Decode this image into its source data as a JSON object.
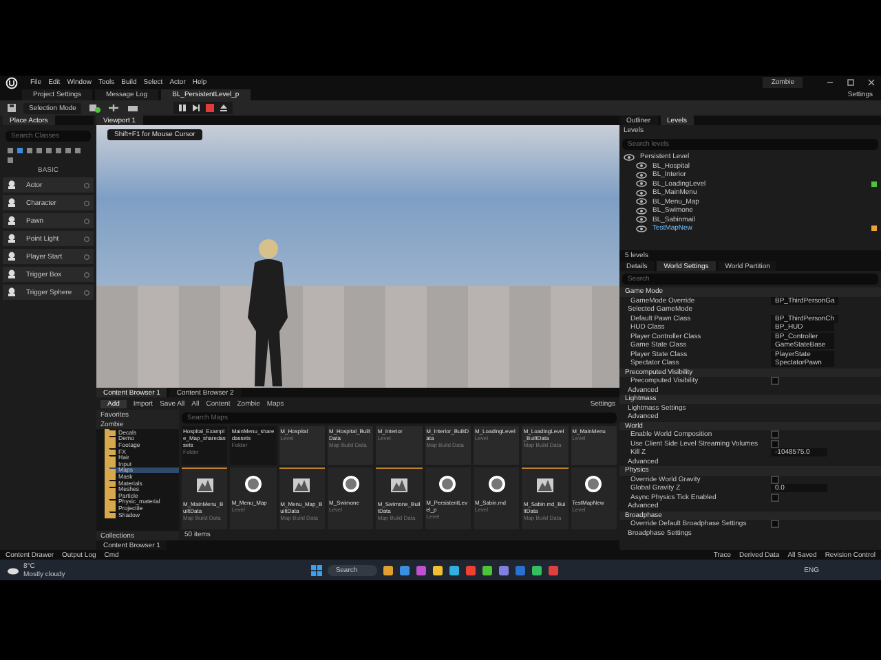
{
  "menu": {
    "items": [
      "File",
      "Edit",
      "Window",
      "Tools",
      "Build",
      "Select",
      "Actor",
      "Help"
    ],
    "project": "Zombie"
  },
  "doc_tabs": [
    {
      "label": "Project Settings",
      "selected": false
    },
    {
      "label": "Message Log",
      "selected": false
    },
    {
      "label": "BL_PersistentLevel_p",
      "selected": true
    }
  ],
  "settings_label": "Settings",
  "toolbar": {
    "mode": "Selection Mode"
  },
  "place_actors": {
    "title": "Place Actors",
    "placeholder": "Search Classes",
    "category": "BASIC",
    "items": [
      "Actor",
      "Character",
      "Pawn",
      "Point Light",
      "Player Start",
      "Trigger Box",
      "Trigger Sphere"
    ]
  },
  "viewport": {
    "tab": "Viewport 1",
    "hint": "Shift+F1 for Mouse Cursor"
  },
  "levels_panel": {
    "tabs": [
      {
        "label": "Outliner",
        "selected": false
      },
      {
        "label": "Levels",
        "selected": true
      }
    ],
    "menu": "Levels",
    "placeholder": "Search levels",
    "footer": "5 levels",
    "levels": [
      {
        "name": "Persistent Level",
        "selected": false,
        "children": [
          {
            "name": "BL_Hospital",
            "selected": false
          },
          {
            "name": "BL_Interior",
            "selected": false
          },
          {
            "name": "BL_LoadingLevel",
            "selected": false,
            "color": "#4cc43a"
          },
          {
            "name": "BL_MainMenu",
            "selected": false
          },
          {
            "name": "BL_Menu_Map",
            "selected": false
          },
          {
            "name": "BL_Swimone",
            "selected": false
          },
          {
            "name": "BL_Sabinmail",
            "selected": false
          },
          {
            "name": "TestMapNew",
            "selected": true,
            "color": "#e8a23a"
          }
        ]
      }
    ]
  },
  "details": {
    "tabs": [
      {
        "label": "Details",
        "selected": false
      },
      {
        "label": "World Settings",
        "selected": true
      },
      {
        "label": "World Partition",
        "selected": false
      }
    ],
    "placeholder": "Search",
    "rows": [
      {
        "kind": "section",
        "label": "Game Mode"
      },
      {
        "kind": "dropdown",
        "label": "GameMode Override",
        "value": "BP_ThirdPersonGa"
      },
      {
        "kind": "group",
        "label": "Selected GameMode"
      },
      {
        "kind": "dropdown",
        "label": "Default Pawn Class",
        "value": "BP_ThirdPersonCh"
      },
      {
        "kind": "dropdown",
        "label": "HUD Class",
        "value": "BP_HUD"
      },
      {
        "kind": "dropdown",
        "label": "Player Controller Class",
        "value": "BP_Controller"
      },
      {
        "kind": "dropdown",
        "label": "Game State Class",
        "value": "GameStateBase"
      },
      {
        "kind": "dropdown",
        "label": "Player State Class",
        "value": "PlayerState"
      },
      {
        "kind": "dropdown",
        "label": "Spectator Class",
        "value": "SpectatorPawn"
      },
      {
        "kind": "section",
        "label": "Precomputed Visibility"
      },
      {
        "kind": "checkbox",
        "label": "Precomputed Visibility",
        "checked": false
      },
      {
        "kind": "group",
        "label": "Advanced"
      },
      {
        "kind": "section",
        "label": "Lightmass"
      },
      {
        "kind": "group",
        "label": "Lightmass Settings"
      },
      {
        "kind": "group",
        "label": "Advanced"
      },
      {
        "kind": "section",
        "label": "World"
      },
      {
        "kind": "checkbox",
        "label": "Enable World Composition",
        "checked": false
      },
      {
        "kind": "checkbox",
        "label": "Use Client Side Level Streaming Volumes",
        "checked": false
      },
      {
        "kind": "text",
        "label": "Kill Z",
        "value": "-1048575.0"
      },
      {
        "kind": "group",
        "label": "Advanced"
      },
      {
        "kind": "section",
        "label": "Physics"
      },
      {
        "kind": "checkbox",
        "label": "Override World Gravity",
        "checked": false
      },
      {
        "kind": "text",
        "label": "Global Gravity Z",
        "value": "0.0"
      },
      {
        "kind": "checkbox",
        "label": "Async Physics Tick Enabled",
        "checked": false
      },
      {
        "kind": "group",
        "label": "Advanced"
      },
      {
        "kind": "section",
        "label": "Broadphase"
      },
      {
        "kind": "checkbox",
        "label": "Override Default Broadphase Settings",
        "checked": false
      },
      {
        "kind": "group",
        "label": "Broadphase Settings"
      }
    ]
  },
  "content_browser": {
    "tabs": [
      {
        "label": "Content Browser 1",
        "selected": true
      },
      {
        "label": "Content Browser 2",
        "selected": false
      }
    ],
    "add": "Add",
    "import": "Import",
    "save_all": "Save All",
    "path": [
      "All",
      "Content",
      "Zombie",
      "Maps"
    ],
    "settings": "Settings",
    "favorites": "Favorites",
    "root": "Zombie",
    "collections": "Collections",
    "placeholder": "Search Maps",
    "count": "50 items",
    "folders": [
      {
        "name": "Decals",
        "selected": false
      },
      {
        "name": "Demo",
        "selected": false
      },
      {
        "name": "Footage",
        "selected": false
      },
      {
        "name": "FX",
        "selected": false
      },
      {
        "name": "Hair",
        "selected": false
      },
      {
        "name": "Input",
        "selected": false
      },
      {
        "name": "Maps",
        "selected": true
      },
      {
        "name": "Mask",
        "selected": false
      },
      {
        "name": "Materials",
        "selected": false
      },
      {
        "name": "Meshes",
        "selected": false
      },
      {
        "name": "Particle",
        "selected": false
      },
      {
        "name": "Physic_material",
        "selected": false
      },
      {
        "name": "Projectile",
        "selected": false
      },
      {
        "name": "Shadow",
        "selected": false
      }
    ],
    "assets": [
      {
        "kind": "folder",
        "name": "Hospital_Example_Map_sharedassets",
        "type": "Folder"
      },
      {
        "kind": "folder",
        "name": "MainMenu_sharedassets",
        "type": "Folder"
      },
      {
        "kind": "cut",
        "name": "M_Hospital",
        "type": "Level"
      },
      {
        "kind": "cut",
        "name": "M_Hospital_BuiltData",
        "type": "Map Build Data"
      },
      {
        "kind": "cut",
        "name": "M_Interior",
        "type": "Level"
      },
      {
        "kind": "cut",
        "name": "M_Interior_BuiltData",
        "type": "Map Build Data"
      },
      {
        "kind": "cut",
        "name": "M_LoadingLevel",
        "type": "Level"
      },
      {
        "kind": "cut",
        "name": "M_LoadingLevel_BuiltData",
        "type": "Map Build Data"
      },
      {
        "kind": "cut",
        "name": "M_MainMenu",
        "type": "Level"
      },
      {
        "kind": "data",
        "name": "M_MainMenu_BuiltData",
        "type": "Map Build Data"
      },
      {
        "kind": "level",
        "name": "M_Menu_Map",
        "type": "Level"
      },
      {
        "kind": "data",
        "name": "M_Menu_Map_BuiltData",
        "type": "Map Build Data"
      },
      {
        "kind": "level",
        "name": "M_Swimone",
        "type": "Level"
      },
      {
        "kind": "data",
        "name": "M_Swimone_BuiltData",
        "type": "Map Build Data"
      },
      {
        "kind": "level",
        "name": "M_PersistentLevel_p",
        "type": "Level"
      },
      {
        "kind": "level",
        "name": "M_Sabin.md",
        "type": "Level"
      },
      {
        "kind": "data",
        "name": "M_Sabin.md_BuiltData",
        "type": "Map Build Data"
      },
      {
        "kind": "level",
        "name": "TestMapNew",
        "type": "Level"
      }
    ],
    "bottom_tab": "Content Browser 1"
  },
  "status_bar": {
    "left": [
      "Content Drawer",
      "Output Log",
      "Cmd"
    ],
    "right": [
      "Trace",
      "Derived Data",
      "All Saved",
      "Revision Control"
    ]
  },
  "taskbar": {
    "temp": "8°C",
    "weather": "Mostly cloudy",
    "search": "Search",
    "lang": "ENG"
  }
}
